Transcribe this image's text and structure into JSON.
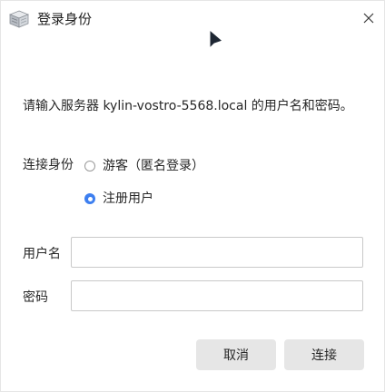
{
  "window": {
    "title": "登录身份",
    "app_icon": "server-icon",
    "close_icon": "close-icon"
  },
  "prompt": "请输入服务器 kylin-vostro-5568.local 的用户名和密码。",
  "connect_as": {
    "label": "连接身份",
    "options": [
      {
        "label": "游客（匿名登录）",
        "selected": false
      },
      {
        "label": "注册用户",
        "selected": true
      }
    ]
  },
  "form": {
    "username_label": "用户名",
    "username_value": "",
    "password_label": "密码",
    "password_value": ""
  },
  "buttons": {
    "cancel": "取消",
    "connect": "连接"
  },
  "colors": {
    "accent": "#3d7ff0",
    "button_bg": "#e6e6e6"
  }
}
